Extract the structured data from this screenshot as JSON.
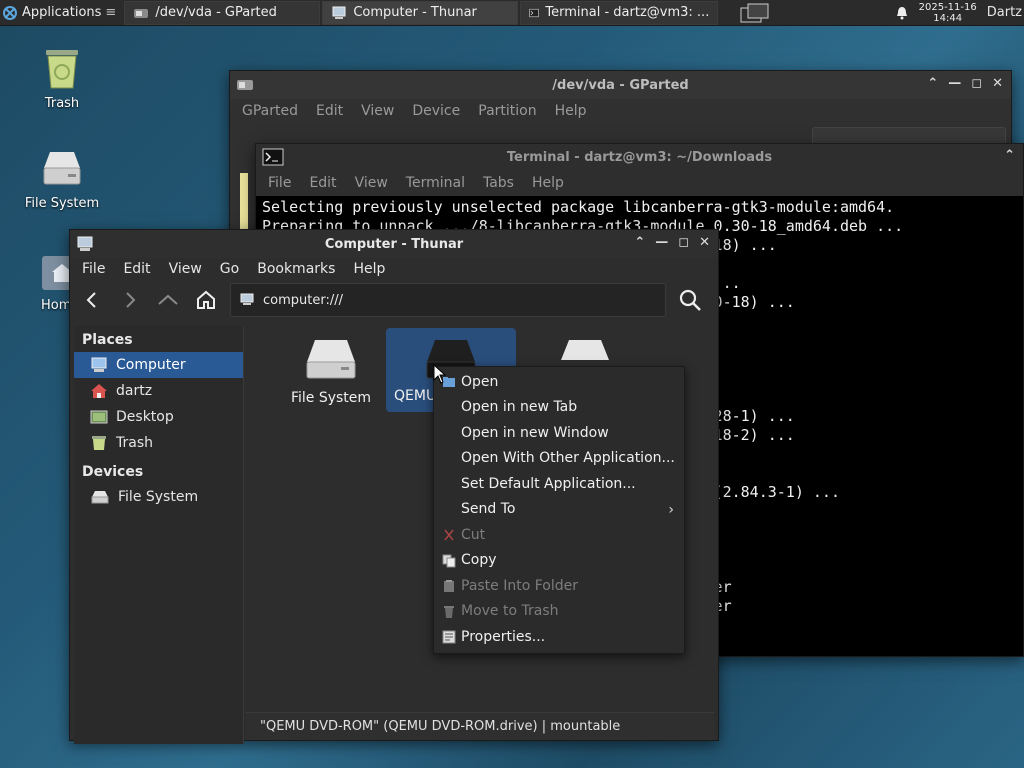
{
  "panel": {
    "applications_label": "Applications",
    "tasks": [
      {
        "label": "/dev/vda - GParted"
      },
      {
        "label": "Computer - Thunar"
      },
      {
        "label": "Terminal - dartz@vm3: ..."
      }
    ],
    "clock_date": "2025-11-16",
    "clock_time": "14:44",
    "user": "Dartz"
  },
  "desktop": {
    "icons": [
      {
        "label": "Trash"
      },
      {
        "label": "File System"
      },
      {
        "label": "Hom"
      }
    ]
  },
  "gparted": {
    "title": "/dev/vda - GParted",
    "menu": [
      "GParted",
      "Edit",
      "View",
      "Device",
      "Partition",
      "Help"
    ]
  },
  "terminal": {
    "title": "Terminal - dartz@vm3: ~/Downloads",
    "menu": [
      "File",
      "Edit",
      "View",
      "Terminal",
      "Tabs",
      "Help"
    ],
    "lines": [
      "Selecting previously unselected package libcanberra-gtk3-module:amd64.",
      "Preparing to unpack .../8-libcanberra-gtk3-module_0.30-18_amd64.deb ...",
      "                                                  18) ...",
      "",
      "                                                  ...",
      "                                                  0-18) ...",
      "",
      "",
      "",
      "",
      "",
      "                                                  28-1) ...",
      "                                                  18-2) ...",
      "",
      "",
      "                                                  (2.84.3-1) ...",
      "",
      "",
      "",
      "",
      "                                                  er",
      "                                                  er"
    ]
  },
  "thunar": {
    "title": "Computer - Thunar",
    "menu": [
      "File",
      "Edit",
      "View",
      "Go",
      "Bookmarks",
      "Help"
    ],
    "location": "computer:///",
    "places_heading": "Places",
    "places": [
      {
        "label": "Computer",
        "icon": "computer-icon"
      },
      {
        "label": "dartz",
        "icon": "home-icon"
      },
      {
        "label": "Desktop",
        "icon": "desktop-icon"
      },
      {
        "label": "Trash",
        "icon": "trash-icon"
      }
    ],
    "devices_heading": "Devices",
    "devices": [
      {
        "label": "File System",
        "icon": "drive-icon"
      }
    ],
    "files": [
      {
        "label": "File System"
      },
      {
        "label": "QEMU"
      },
      {
        "label": ""
      }
    ],
    "status": "\"QEMU DVD-ROM\" (QEMU DVD-ROM.drive)  |  mountable"
  },
  "context_menu": {
    "items": [
      {
        "label": "Open",
        "disabled": false
      },
      {
        "label": "Open in new Tab",
        "disabled": false
      },
      {
        "label": "Open in new Window",
        "disabled": false
      },
      {
        "label": "Open With Other Application...",
        "disabled": false
      },
      {
        "label": "Set Default Application...",
        "disabled": false
      },
      {
        "label": "Send To",
        "disabled": false
      },
      {
        "label": "Cut",
        "disabled": true
      },
      {
        "label": "Copy",
        "disabled": false
      },
      {
        "label": "Paste Into Folder",
        "disabled": true
      },
      {
        "label": "Move to Trash",
        "disabled": true
      },
      {
        "label": "Properties...",
        "disabled": false
      }
    ]
  },
  "colors": {
    "selection": "#2a5a96",
    "panel": "#2b2b2b",
    "desktop": "#245a78"
  }
}
